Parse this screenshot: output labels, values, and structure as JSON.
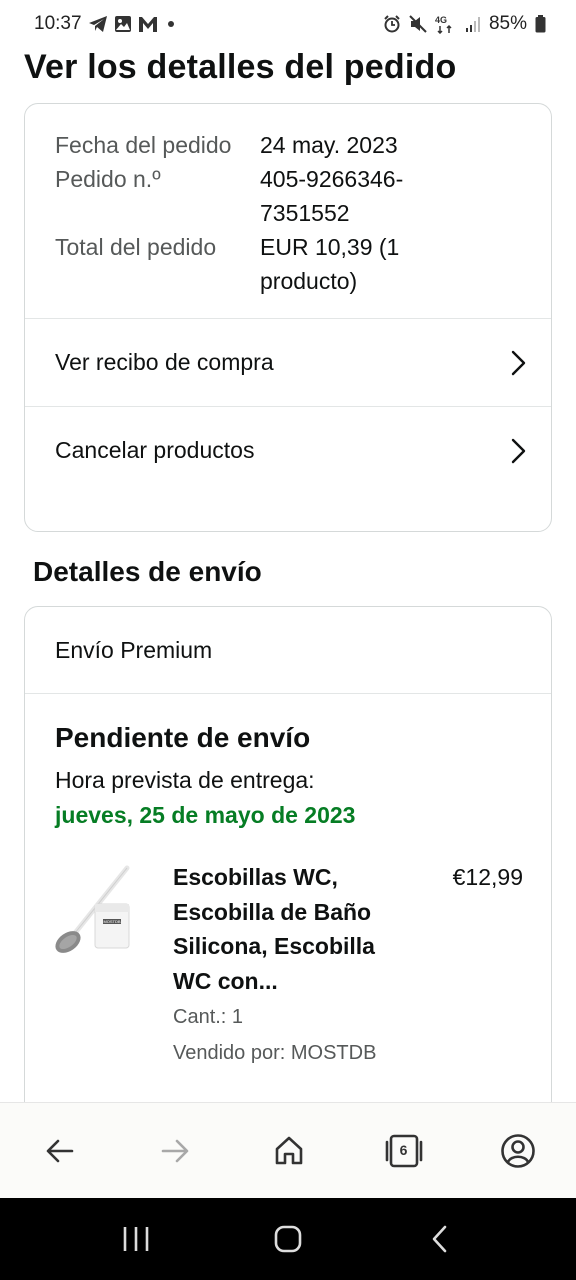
{
  "status_bar": {
    "time": "10:37",
    "notification_icons": [
      "telegram-icon",
      "gallery-icon",
      "gmail-icon",
      "dot-icon"
    ],
    "system_icons": [
      "alarm-icon",
      "mute-icon",
      "4g-signal-icon",
      "signal-bars-icon",
      "battery-icon"
    ],
    "network": "4G",
    "battery": "85%"
  },
  "page": {
    "title": "Ver los detalles del pedido"
  },
  "order_summary": {
    "rows": [
      {
        "label": "Fecha del pedido",
        "value": "24 may. 2023"
      },
      {
        "label": "Pedido n.º",
        "value": "405-9266346-7351552"
      },
      {
        "label": "Total del pedido",
        "value": "EUR 10,39 (1 producto)"
      }
    ],
    "links": [
      {
        "label": "Ver recibo de compra"
      },
      {
        "label": "Cancelar productos"
      }
    ]
  },
  "shipping": {
    "section_title": "Detalles de envío",
    "ship_type": "Envío Premium",
    "status": "Pendiente de envío",
    "eta_label": "Hora prevista de entrega:",
    "eta_date": "jueves, 25 de mayo de 2023",
    "product": {
      "name": "Escobillas WC, Escobilla de Baño Silicona, Escobilla WC con...",
      "price": "€12,99",
      "quantity": "Cant.: 1",
      "seller": "Vendido por: MOSTDB",
      "image_label": "MOSTDB"
    }
  },
  "browser_bar": {
    "buttons": [
      "back-arrow-icon",
      "forward-arrow-icon",
      "home-icon",
      "tabs-icon",
      "account-icon"
    ],
    "tab_count": "6"
  },
  "nav_bar": {
    "buttons": [
      "recents-icon",
      "home-circle-icon",
      "back-chevron-icon"
    ]
  },
  "colors": {
    "eta_green": "#067d24",
    "text_primary": "#0f1111",
    "text_secondary": "#565959",
    "card_border": "#d5d9d9"
  }
}
